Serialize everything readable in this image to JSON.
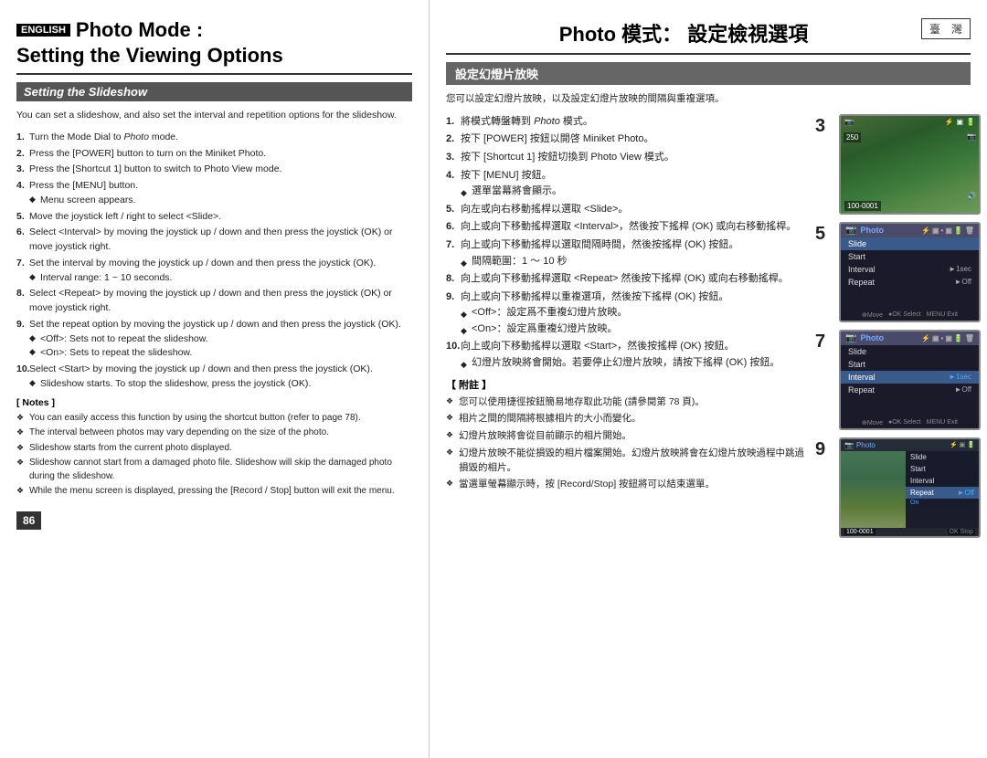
{
  "left": {
    "english_badge": "ENGLISH",
    "title_line1": "Photo Mode :",
    "title_line2": "Setting the Viewing Options",
    "section_title": "Setting the Slideshow",
    "intro": "You can set a slideshow, and also set the interval and repetition options for the slideshow.",
    "steps": [
      {
        "num": "1.",
        "text": "Turn the Mode Dial to Photo mode.",
        "italic_word": "Photo"
      },
      {
        "num": "2.",
        "text": "Press the [POWER] button to turn on the Miniket Photo."
      },
      {
        "num": "3.",
        "text": "Press the [Shortcut 1] button to switch to Photo View mode."
      },
      {
        "num": "4.",
        "text": "Press the [MENU] button.",
        "sub": "Menu screen appears."
      },
      {
        "num": "5.",
        "text": "Move the joystick left / right to select <Slide>."
      },
      {
        "num": "6.",
        "text": "Select <Interval> by moving the joystick up / down and then press the joystick (OK) or move joystick right."
      },
      {
        "num": "7.",
        "text": "Set the interval by moving the joystick up / down and then press the joystick (OK).",
        "sub": "Interval range: 1 ~ 10 seconds."
      },
      {
        "num": "8.",
        "text": "Select <Repeat> by moving the joystick up / down and then press the joystick (OK) or move joystick right."
      },
      {
        "num": "9.",
        "text": "Set the repeat option by moving the joystick up / down and then press the joystick (OK).",
        "sub1": "<Off>: Sets not to repeat the slideshow.",
        "sub2": "<On>: Sets to repeat the slideshow."
      },
      {
        "num": "10.",
        "text": "Select <Start> by moving the joystick up / down and then press the joystick (OK).",
        "sub": "Slideshow starts. To stop the slideshow, press the joystick (OK)."
      }
    ],
    "notes_header": "[ Notes ]",
    "notes": [
      "You can easily access this function by using the shortcut button (refer to page 78).",
      "The interval between photos may vary depending on the size of the photo.",
      "Slideshow starts from the current photo displayed.",
      "Slideshow cannot start from a damaged photo file. Slideshow will skip the damaged photo during the slideshow.",
      "While the menu screen is displayed, pressing the [Record / Stop] button will exit the menu."
    ],
    "page_number": "86"
  },
  "right": {
    "taiwan_badge": "臺　灣",
    "chinese_title": "Photo 模式： 設定檢視選項",
    "section_title": "設定幻燈片放映",
    "intro": "您可以設定幻燈片放映，以及設定幻燈片放映的間隔與重複選項。",
    "steps": [
      {
        "num": "1.",
        "text": "將模式轉盤轉到 Photo 模式。"
      },
      {
        "num": "2.",
        "text": "按下 [POWER] 按鈕以開啓 Miniket Photo。"
      },
      {
        "num": "3.",
        "text": "按下 [Shortcut 1] 按鈕切換到 Photo View 模式。"
      },
      {
        "num": "4.",
        "text": "按下 [MENU] 按鈕。",
        "sub": "選單當幕將會顯示。"
      },
      {
        "num": "5.",
        "text": "向左或向右移動搖桿以選取 <Slide>。"
      },
      {
        "num": "6.",
        "text": "向上或向下移動搖桿選取 <Interval>，然後按下搖桿 (OK) 或向右移動搖桿。"
      },
      {
        "num": "7.",
        "text": "向上或向下移動搖桿以選取間隔時間，然後按搖桿 (OK) 按鈕。",
        "sub": "間隔範圍：1 ～ 10 秒"
      },
      {
        "num": "8.",
        "text": "向上或向下移動搖桿選取 <Repeat> 然後按下搖桿 (OK) 或向右移動搖桿。"
      },
      {
        "num": "9.",
        "text": "向上或向下移動搖桿以重複選項，然後按下搖桿 (OK) 按鈕。",
        "sub1": "<Off>：設定爲不重複幻燈片放映。",
        "sub2": "<On>：設定爲重複幻燈片放映。"
      },
      {
        "num": "10.",
        "text": "向上或向下移動搖桿以選取 <Start>，然後按搖桿 (OK) 按鈕。",
        "sub": "幻燈片放映將會開始。若要停止幻燈片放映，請按下搖桿 (OK) 按鈕。"
      }
    ],
    "notes_header": "【 附註 】",
    "notes": [
      "您可以使用捷徑按鈕簡易地存取此功能 (請參閱第 78 頁)。",
      "相片之間的間隔將根據相片的大小而變化。",
      "幻燈片放映將會從目前顯示的相片開始。",
      "幻燈片放映不能從損毀的相片檔案開始。幻燈片放映將會在幻燈片放映過程中跳過損毀的相片。",
      "當選單螢幕顯示時，按 [Record/Stop] 按鈕將可以結束選單。"
    ]
  },
  "screens": {
    "screen3_step": "3",
    "screen5_step": "5",
    "screen7_step": "7",
    "screen9_step": "9",
    "menu_title": "Photo",
    "menu_items": [
      {
        "label": "Slide",
        "value": ""
      },
      {
        "label": "Start",
        "value": ""
      },
      {
        "label": "Interval",
        "value": "►1sec"
      },
      {
        "label": "Repeat",
        "value": "►Off"
      }
    ],
    "menu_items2": [
      {
        "label": "Slide",
        "value": ""
      },
      {
        "label": "Start",
        "value": ""
      },
      {
        "label": "Interval",
        "value": ""
      },
      {
        "label": "Repeat",
        "value": "►Off"
      }
    ],
    "counter1": "100-0001",
    "counter2": "100-0001",
    "ok_stop": "OK Stop"
  }
}
